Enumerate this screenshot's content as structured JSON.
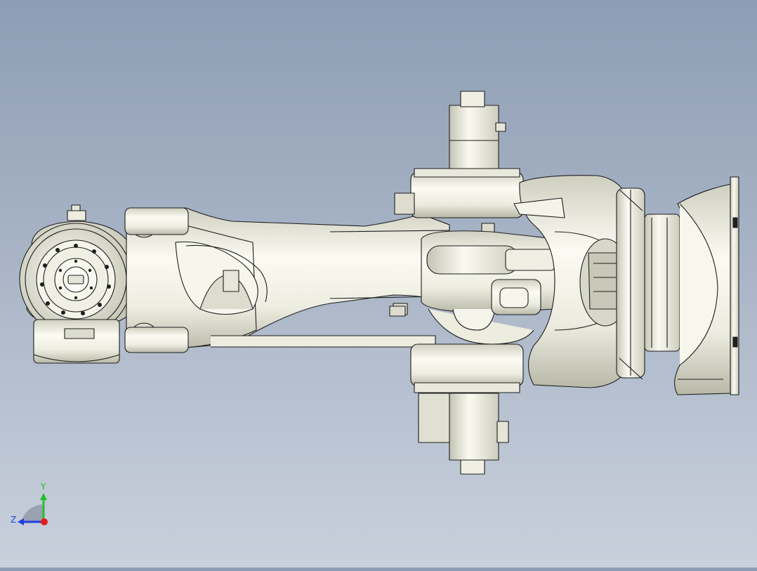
{
  "viewport": {
    "background_top": "#8e9db4",
    "background_bottom": "#c9d0dc",
    "model_fill": "#f1f1e6",
    "model_shade": "#c8c8b8",
    "model_edge": "#1e1e1e"
  },
  "triad": {
    "y_label": "Y",
    "z_label": "Z",
    "x_color": "#e21b1b",
    "y_color": "#22c02a",
    "z_color": "#1f3fe0"
  }
}
